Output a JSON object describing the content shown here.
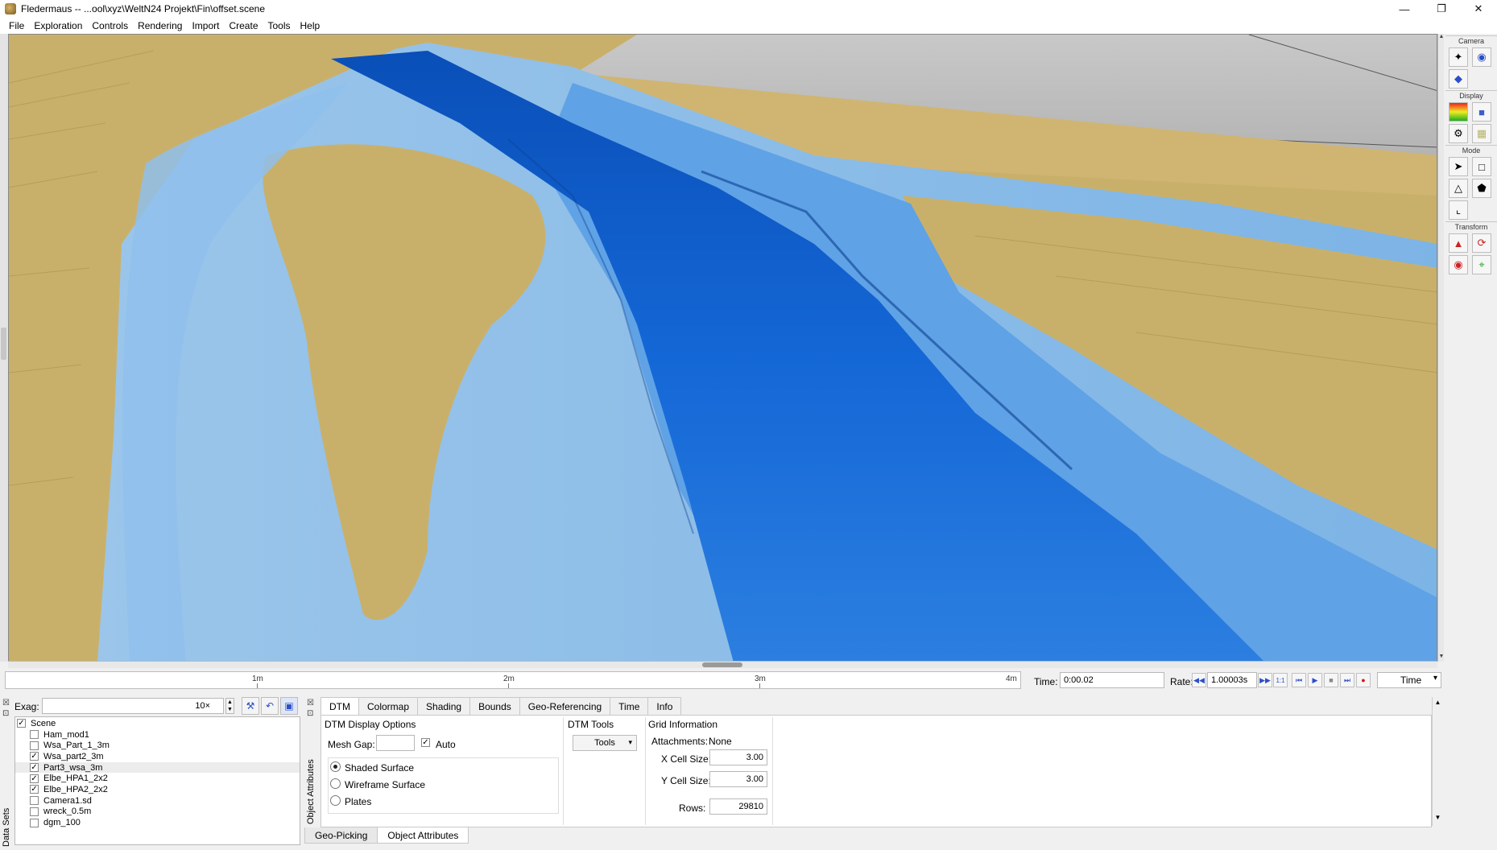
{
  "window": {
    "title": "Fledermaus -- ...ool\\xyz\\WeltN24 Projekt\\Fin\\offset.scene"
  },
  "menu": [
    "File",
    "Exploration",
    "Controls",
    "Rendering",
    "Import",
    "Create",
    "Tools",
    "Help"
  ],
  "toolbar": {
    "groups": {
      "camera": "Camera",
      "display": "Display",
      "mode": "Mode",
      "transform": "Transform"
    }
  },
  "timeline": {
    "ticks": [
      "1m",
      "2m",
      "3m",
      "4m"
    ],
    "time_label": "Time:",
    "time_value": "0:00.02",
    "rate_label": "Rate:",
    "rate_value": "1.00003s",
    "mode_select": "Time"
  },
  "datasets": {
    "panel_label": "Data Sets",
    "exag_label": "Exag:",
    "exag_value": "10×",
    "items": [
      {
        "label": "Scene",
        "checked": true,
        "indent": 0
      },
      {
        "label": "Ham_mod1",
        "checked": false,
        "indent": 1
      },
      {
        "label": "Wsa_Part_1_3m",
        "checked": false,
        "indent": 1
      },
      {
        "label": "Wsa_part2_3m",
        "checked": true,
        "indent": 1
      },
      {
        "label": "Part3_wsa_3m",
        "checked": true,
        "indent": 1
      },
      {
        "label": "Elbe_HPA1_2x2",
        "checked": true,
        "indent": 1
      },
      {
        "label": "Elbe_HPA2_2x2",
        "checked": true,
        "indent": 1
      },
      {
        "label": "Camera1.sd",
        "checked": false,
        "indent": 1
      },
      {
        "label": "wreck_0.5m",
        "checked": false,
        "indent": 1
      },
      {
        "label": "dgm_100",
        "checked": false,
        "indent": 1
      }
    ]
  },
  "attributes": {
    "panel_label": "Object Attributes",
    "tabs": [
      "DTM",
      "Colormap",
      "Shading",
      "Bounds",
      "Geo-Referencing",
      "Time",
      "Info"
    ],
    "display_options": {
      "title": "DTM Display Options",
      "mesh_gap_label": "Mesh Gap:",
      "mesh_gap_value": "",
      "auto_label": "Auto",
      "auto_checked": true,
      "radios": [
        "Shaded Surface",
        "Wireframe Surface",
        "Plates"
      ],
      "selected": "Shaded Surface"
    },
    "dtm_tools": {
      "title": "DTM Tools",
      "button": "Tools"
    },
    "grid_info": {
      "title": "Grid Information",
      "attachments_label": "Attachments:",
      "attachments_value": "None",
      "x_cell_label": "X Cell Size:",
      "x_cell_value": "3.00",
      "y_cell_label": "Y Cell Size:",
      "y_cell_value": "3.00",
      "rows_label": "Rows:",
      "rows_value": "29810"
    }
  },
  "bottom_tabs": [
    "Geo-Picking",
    "Object Attributes"
  ]
}
